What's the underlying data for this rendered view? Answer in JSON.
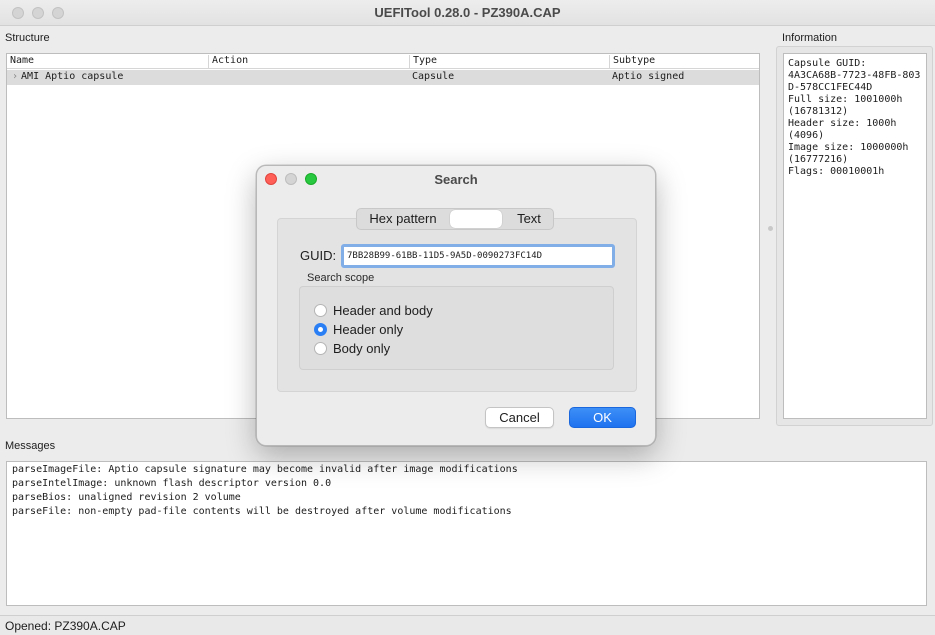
{
  "window": {
    "title": "UEFITool 0.28.0 - PZ390A.CAP"
  },
  "structure": {
    "label": "Structure",
    "columns": [
      "Name",
      "Action",
      "Type",
      "Subtype"
    ],
    "rows": [
      {
        "name": "AMI Aptio capsule",
        "action": "",
        "type": "Capsule",
        "subtype": "Aptio signed"
      }
    ]
  },
  "information": {
    "label": "Information",
    "lines": [
      "Capsule GUID:",
      "4A3CA68B-7723-48FB-803",
      "D-578CC1FEC44D",
      "Full size: 1001000h",
      "(16781312)",
      "Header size: 1000h",
      "(4096)",
      "Image size: 1000000h",
      "(16777216)",
      "Flags: 00010001h"
    ]
  },
  "messages": {
    "label": "Messages",
    "lines": [
      "parseImageFile: Aptio capsule signature may become invalid after image modifications",
      "parseIntelImage: unknown flash descriptor version 0.0",
      "parseBios: unaligned revision 2 volume",
      "parseFile: non-empty pad-file contents will be destroyed after volume modifications"
    ]
  },
  "status": {
    "text": "Opened: PZ390A.CAP"
  },
  "dialog": {
    "title": "Search",
    "tabs": {
      "hex": "Hex pattern",
      "guid": "",
      "text": "Text"
    },
    "guid_label": "GUID:",
    "guid_value": "7BB28B99-61BB-11D5-9A5D-0090273FC14D",
    "scope_label": "Search scope",
    "scope_options": [
      "Header and body",
      "Header only",
      "Body only"
    ],
    "scope_selected": "Header only",
    "cancel_label": "Cancel",
    "ok_label": "OK",
    "ok_color": "#1f72ef"
  }
}
